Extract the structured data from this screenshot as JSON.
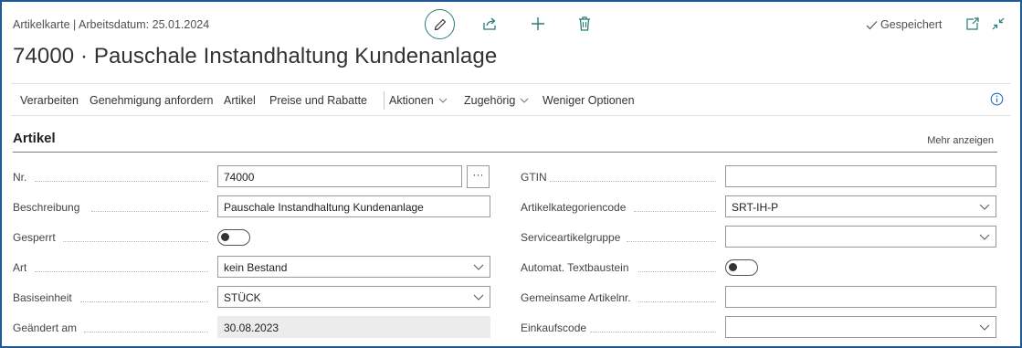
{
  "header": {
    "breadcrumb": "Artikelkarte | Arbeitsdatum: 25.01.2024",
    "title": "74000 · Pauschale Instandhaltung Kundenanlage",
    "saved_status": "Gespeichert",
    "icons": [
      "edit-icon",
      "share-icon",
      "new-icon",
      "delete-icon",
      "open-new-window-icon",
      "collapse-icon"
    ]
  },
  "actions": {
    "verarbeiten": "Verarbeiten",
    "genehmigung": "Genehmigung anfordern",
    "artikel": "Artikel",
    "preise": "Preise und Rabatte",
    "aktionen": "Aktionen",
    "zugehoerig": "Zugehörig",
    "weniger": "Weniger Optionen"
  },
  "section": {
    "title": "Artikel",
    "more_label": "Mehr anzeigen"
  },
  "fields_left": {
    "nr": {
      "label": "Nr.",
      "value": "74000",
      "assist_button": "···"
    },
    "beschreibung": {
      "label": "Beschreibung",
      "value": "Pauschale Instandhaltung Kundenanlage"
    },
    "gesperrt": {
      "label": "Gesperrt",
      "value": "off"
    },
    "art": {
      "label": "Art",
      "value": "kein Bestand"
    },
    "basiseinheit": {
      "label": "Basiseinheit",
      "value": "STÜCK"
    },
    "geaendert_am": {
      "label": "Geändert am",
      "value": "30.08.2023"
    }
  },
  "fields_right": {
    "gtin": {
      "label": "GTIN",
      "value": ""
    },
    "artikelkategoriencode": {
      "label": "Artikelkategoriencode",
      "value": "SRT-IH-P"
    },
    "serviceartikelgruppe": {
      "label": "Serviceartikelgruppe",
      "value": ""
    },
    "textbaustein": {
      "label": "Automat. Textbaustein",
      "value": "off"
    },
    "gemeinsame_artikelnr": {
      "label": "Gemeinsame Artikelnr.",
      "value": ""
    },
    "einkaufscode": {
      "label": "Einkaufscode",
      "value": ""
    }
  },
  "colors": {
    "accent": "#2a7a7e",
    "frame": "#1f5a96",
    "info": "#1f6fbf"
  }
}
